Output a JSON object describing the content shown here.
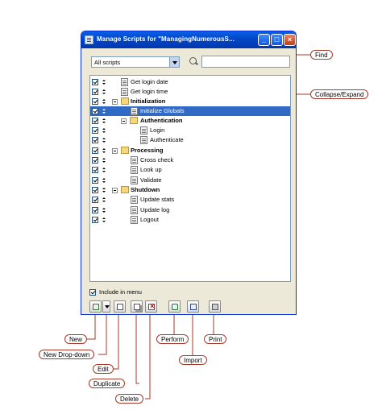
{
  "window": {
    "title": "Manage Scripts for \"ManagingNumerousS...",
    "min_label": "_",
    "max_label": "□",
    "close_label": "×"
  },
  "filter": {
    "selected": "All scripts"
  },
  "tree": {
    "rows": [
      {
        "label": "Get login date",
        "bold": false
      },
      {
        "label": "Get login time",
        "bold": false
      },
      {
        "label": "Initialization",
        "bold": true
      },
      {
        "label": "Initialize Globals",
        "bold": false,
        "selected": true
      },
      {
        "label": "Authentication",
        "bold": true
      },
      {
        "label": "Login",
        "bold": false
      },
      {
        "label": "Authenticate",
        "bold": false
      },
      {
        "label": "Processing",
        "bold": true
      },
      {
        "label": "Cross check",
        "bold": false
      },
      {
        "label": "Look up",
        "bold": false
      },
      {
        "label": "Validate",
        "bold": false
      },
      {
        "label": "Shutdown",
        "bold": true
      },
      {
        "label": "Update stats",
        "bold": false
      },
      {
        "label": "Update log",
        "bold": false
      },
      {
        "label": "Logout",
        "bold": false
      }
    ]
  },
  "include_in_menu": {
    "label": "Include in menu",
    "checked": true
  },
  "callouts": {
    "find": "Find",
    "collapse_expand": "Collapse/Expand",
    "new": "New",
    "new_dropdown": "New Drop-down",
    "edit": "Edit",
    "duplicate": "Duplicate",
    "delete": "Delete",
    "perform": "Perform",
    "import": "Import",
    "print": "Print"
  },
  "colors": {
    "callout_border": "#a53a2a",
    "selection": "#316ac5",
    "titlebar": "#0147c5"
  }
}
